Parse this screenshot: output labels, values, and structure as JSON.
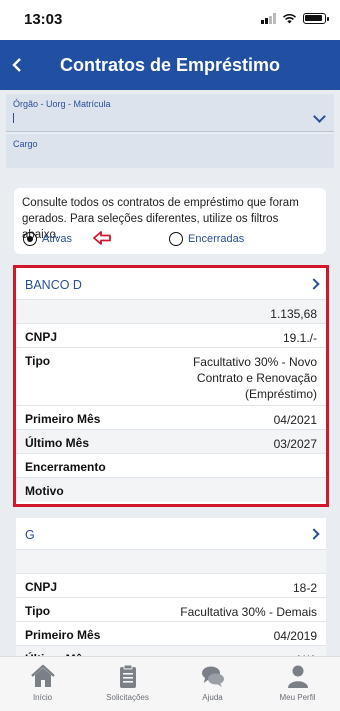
{
  "status": {
    "time": "13:03"
  },
  "header": {
    "title": "Contratos de Empréstimo"
  },
  "filters": {
    "orgao_label": "Órgão - Uorg - Matrícula",
    "cargo_label": "Cargo"
  },
  "info": {
    "text": "Consulte todos os contratos de empréstimo que foram gerados. Para seleções diferentes, utilize os filtros abaixo.",
    "options": [
      {
        "label": "Ativas",
        "selected": true
      },
      {
        "label": "Encerradas",
        "selected": false
      }
    ]
  },
  "contracts": [
    {
      "bank": "BANCO D",
      "amount": "1.135,68",
      "cnpj_label": "CNPJ",
      "cnpj": "19.1./-",
      "tipo_label": "Tipo",
      "tipo": "Facultativo 30% - Novo Contrato e Renovação (Empréstimo)",
      "primeiro_label": "Primeiro Mês",
      "primeiro": "04/2021",
      "ultimo_label": "Último Mês",
      "ultimo": "03/2027",
      "encerramento_label": "Encerramento",
      "encerramento": "",
      "motivo_label": "Motivo",
      "motivo": ""
    },
    {
      "bank": "G",
      "amount": "",
      "cnpj_label": "CNPJ",
      "cnpj": "18-2",
      "tipo_label": "Tipo",
      "tipo": "Facultativa 30% - Demais",
      "primeiro_label": "Primeiro Mês",
      "primeiro": "04/2019",
      "ultimo_label": "Último Mês",
      "ultimo": "N/A"
    }
  ],
  "tabbar": [
    {
      "label": "Início",
      "icon": "home-icon"
    },
    {
      "label": "Solicitações",
      "icon": "clipboard-icon"
    },
    {
      "label": "Ajuda",
      "icon": "chat-bubbles-icon"
    },
    {
      "label": "Meu Perfil",
      "icon": "user-icon"
    }
  ],
  "colors": {
    "primary": "#2150a3",
    "highlight": "#d0172c"
  }
}
